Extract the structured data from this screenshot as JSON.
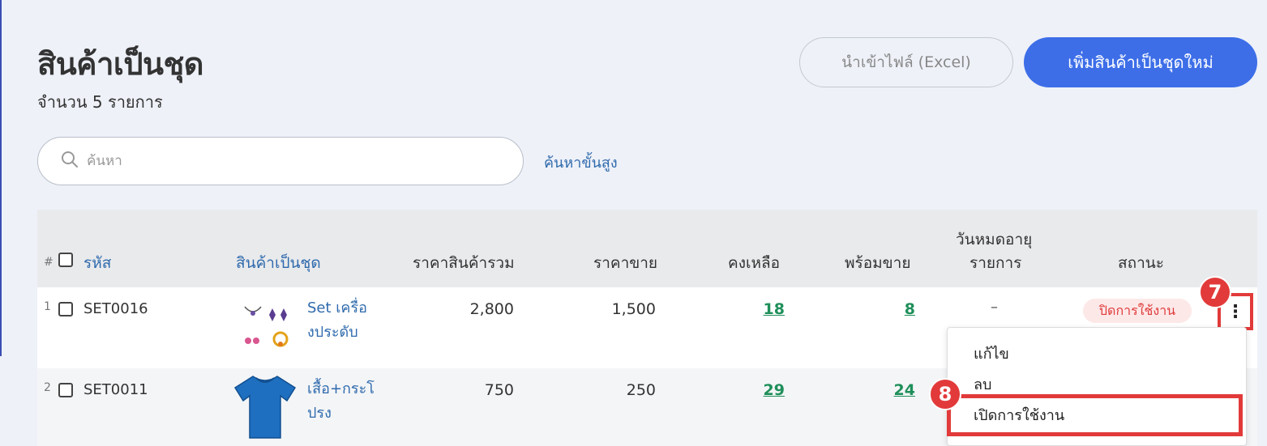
{
  "header": {
    "title": "สินค้าเป็นชุด",
    "subtitle": "จำนวน 5 รายการ",
    "import_label": "นำเข้าไฟล์ (Excel)",
    "add_label": "เพิ่มสินค้าเป็นชุดใหม่"
  },
  "search": {
    "placeholder": "ค้นหา",
    "advanced_label": "ค้นหาขั้นสูง"
  },
  "table": {
    "headers": {
      "hash": "#",
      "code": "รหัส",
      "product": "สินค้าเป็นชุด",
      "total_price": "ราคาสินค้ารวม",
      "sale_price": "ราคาขาย",
      "remaining": "คงเหลือ",
      "ready": "พร้อมขาย",
      "expiry_line1": "วันหมดอายุ",
      "expiry_line2": "รายการ",
      "status": "สถานะ"
    },
    "rows": [
      {
        "index": "1",
        "code": "SET0016",
        "name_line1": "Set เครื่อ",
        "name_line2": "งประดับ",
        "total_price": "2,800",
        "sale_price": "1,500",
        "remaining": "18",
        "ready": "8",
        "expiry": "–",
        "status": "ปิดการใช้งาน",
        "thumbnail": "jewelry-set-icon"
      },
      {
        "index": "2",
        "code": "SET0011",
        "name_line1": "เสื้อ+กระโ",
        "name_line2": "ปรง",
        "total_price": "750",
        "sale_price": "250",
        "remaining": "29",
        "ready": "24",
        "thumbnail": "tshirt-icon"
      }
    ]
  },
  "menu": {
    "items": [
      "แก้ไข",
      "ลบ",
      "เปิดการใช้งาน"
    ]
  },
  "annotations": {
    "step_7": "7",
    "step_8": "8"
  },
  "colors": {
    "primary": "#3d6ee8",
    "link": "#2f6aad",
    "green_link": "#1f8f5a",
    "danger": "#e23a3a",
    "badge_bg": "#fde8e8"
  }
}
